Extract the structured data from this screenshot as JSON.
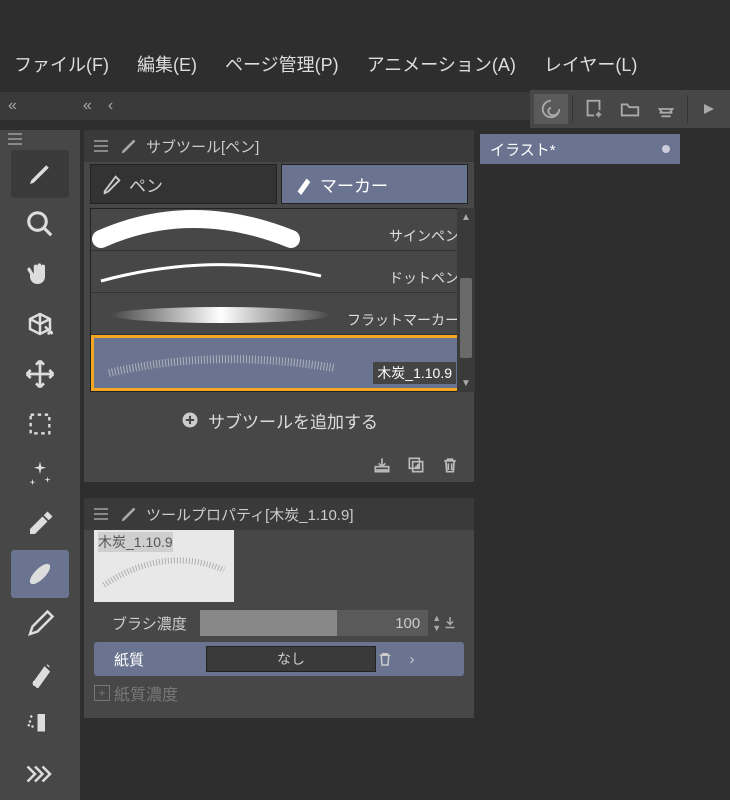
{
  "menu": {
    "file": "ファイル(F)",
    "edit": "編集(E)",
    "page": "ページ管理(P)",
    "anim": "アニメーション(A)",
    "layer": "レイヤー(L)"
  },
  "doc_tab": {
    "name": "イラスト*"
  },
  "subtool": {
    "title": "サブツール[ペン]",
    "tab_pen": "ペン",
    "tab_marker": "マーカー",
    "items": {
      "sign": "サインペン",
      "dot": "ドットペン",
      "flat": "フラットマーカー",
      "charcoal": "木炭_1.10.9"
    },
    "add": "サブツールを追加する"
  },
  "toolprop": {
    "title": "ツールプロパティ[木炭_1.10.9]",
    "preview_label": "木炭_1.10.9",
    "density_label": "ブラシ濃度",
    "density_value": "100",
    "paper_label": "紙質",
    "paper_value": "なし",
    "paper_density_label": "紙質濃度"
  }
}
